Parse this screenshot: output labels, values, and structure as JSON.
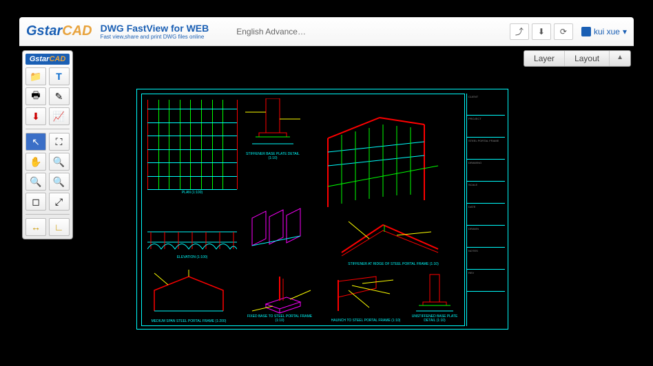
{
  "header": {
    "logo_first": "Gstar",
    "logo_second": "CAD",
    "title": "DWG FastView for WEB",
    "subtitle": "Fast view,share and print DWG files online",
    "language": "English Advance…",
    "user_name": "kui xue",
    "user_caret": "▾"
  },
  "toolbar": {
    "logo_first": "Gstar",
    "logo_second": "CAD"
  },
  "right_panel": {
    "tab_layer": "Layer",
    "tab_layout": "Layout",
    "collapse": "▲"
  },
  "drawing": {
    "plan_label": "PLAN (1:100)",
    "elevation_label": "ELEVATION (1:100)",
    "detail1_label": "STIFFENER BASE PLATE DETAIL (1:10)",
    "stiffener_label": "STIFFENER AT RIDGE OF STEEL PORTAL FRAME (1:10)",
    "portal_label": "MEDIUM SPAN STEEL PORTAL FRAME (1:200)",
    "base_label": "FIXED BASE TO STEEL PORTAL FRAME (1:10)",
    "haunch_label": "HAUNCH TO STEEL PORTAL FRAME (1:10)",
    "ubase_label": "UNSTIFFENED BASE PLATE DETAIL (1:10)"
  },
  "info": {
    "r1": "CLIENT",
    "r2": "PROJECT",
    "r3": "STEEL PORTAL FRAME",
    "r4": "DRAWING",
    "r5": "SCALE",
    "r6": "DATE",
    "r7": "DRAWN",
    "r8": "NOTES",
    "r9": "REV"
  }
}
